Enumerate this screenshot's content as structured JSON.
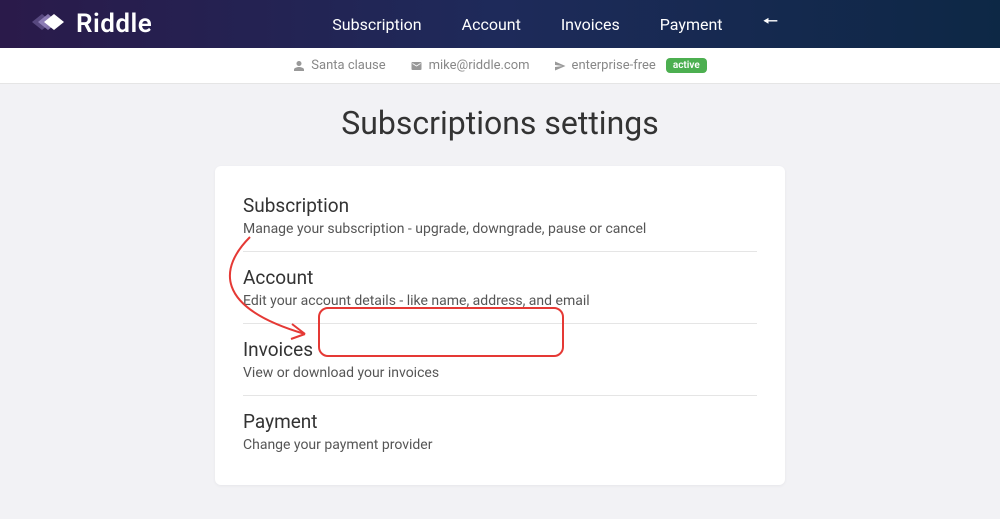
{
  "brand": "Riddle",
  "nav": {
    "items": [
      "Subscription",
      "Account",
      "Invoices",
      "Payment"
    ]
  },
  "user": {
    "name": "Santa clause",
    "email": "mike@riddle.com",
    "plan": "enterprise-free",
    "status": "active"
  },
  "page": {
    "title": "Subscriptions settings"
  },
  "settings": [
    {
      "title": "Subscription",
      "desc": "Manage your subscription - upgrade, downgrade, pause or cancel"
    },
    {
      "title": "Account",
      "desc": "Edit your account details - like name, address, and email"
    },
    {
      "title": "Invoices",
      "desc": "View or download your invoices"
    },
    {
      "title": "Payment",
      "desc": "Change your payment provider"
    }
  ]
}
